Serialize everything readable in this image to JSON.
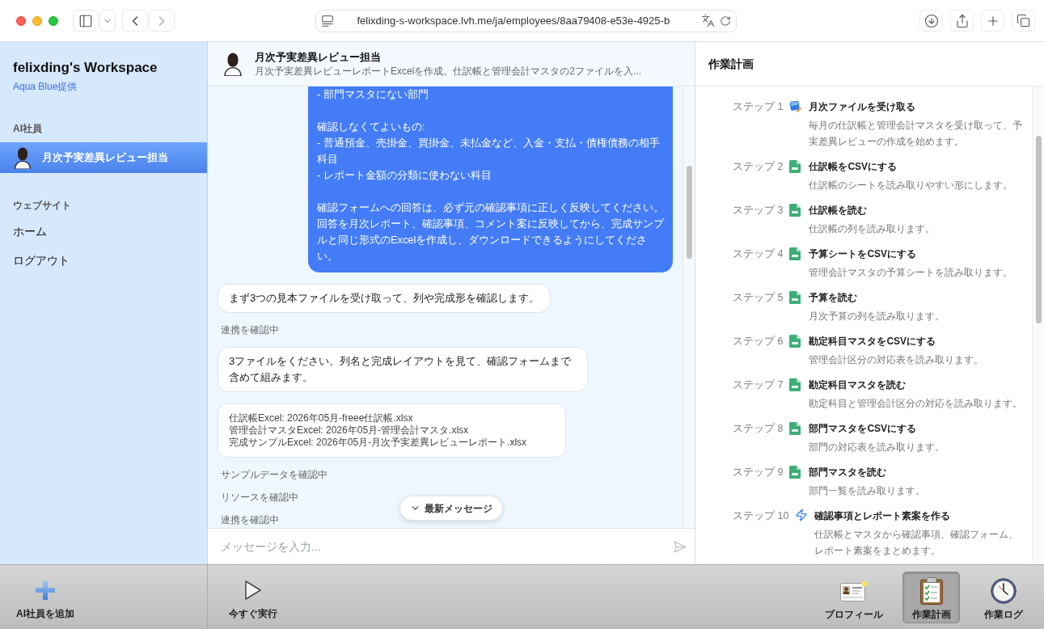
{
  "browser": {
    "url": "felixding-s-workspace.lvh.me/ja/employees/8aa79408-e53e-4925-b"
  },
  "sidebar": {
    "title": "felixding's Workspace",
    "provider": "Aqua Blue提供",
    "sections": [
      {
        "label": "AI社員",
        "items": [
          {
            "kind": "employee",
            "label": "月次予実差異レビュー担当",
            "selected": true
          }
        ]
      },
      {
        "label": "ウェブサイト",
        "items": [
          {
            "kind": "link",
            "label": "ホーム",
            "selected": false
          },
          {
            "kind": "link",
            "label": "ログアウト",
            "selected": false
          }
        ]
      }
    ]
  },
  "chat": {
    "title": "月次予実差異レビュー担当",
    "subtitle": "月次予実差異レビューレポートExcelを作成。仕訳帳と管理会計マスタの2ファイルを入...",
    "messages": [
      {
        "kind": "user",
        "paragraphs": [
          [
            "- 部門マスタにない部門"
          ],
          [
            "確認しなくてよいもの:",
            "- 普通預金、売掛金、買掛金、未払金など、入金・支払・債権債務の相手科目",
            "- レポート金額の分類に使わない科目"
          ],
          [
            "確認フォームへの回答は、必ず元の確認事項に正しく反映してください。回答を月次レポート、確認事項、コメント案に反映してから、完成サンプルと同じ形式のExcelを作成し、ダウンロードできるようにしてください。"
          ]
        ]
      },
      {
        "kind": "assistant",
        "text": "まず3つの見本ファイルを受け取って、列や完成形を確認します。"
      },
      {
        "kind": "status",
        "text": "連携を確認中"
      },
      {
        "kind": "assistant",
        "text": "3ファイルをください。列名と完成レイアウトを見て、確認フォームまで含めて組みます。"
      },
      {
        "kind": "files",
        "lines": [
          "仕訳帳Excel: 2026年05月-freee仕訳帳.xlsx",
          "管理会計マスタExcel: 2026年05月-管理会計マスタ.xlsx",
          "完成サンプルExcel: 2026年05月-月次予実差異レビューレポート.xlsx"
        ]
      },
      {
        "kind": "status",
        "text": "サンプルデータを確認中"
      },
      {
        "kind": "status",
        "text": "リソースを確認中"
      },
      {
        "kind": "status",
        "text": "連携を確認中"
      }
    ],
    "jump_button": "最新メッセージ",
    "input": {
      "placeholder": "メッセージを入力..."
    }
  },
  "plan": {
    "title": "作業計画",
    "steps": [
      {
        "kind": "intake",
        "label": "ステップ 1",
        "title": "月次ファイルを受け取る",
        "description": "毎月の仕訳帳と管理会計マスタを受け取って、予実差異レビューの作成を始めます。"
      },
      {
        "kind": "csv",
        "label": "ステップ 2",
        "title": "仕訳帳をCSVにする",
        "description": "仕訳帳のシートを読み取りやすい形にします。"
      },
      {
        "kind": "csv",
        "label": "ステップ 3",
        "title": "仕訳帳を読む",
        "description": "仕訳帳の列を読み取ります。"
      },
      {
        "kind": "csv",
        "label": "ステップ 4",
        "title": "予算シートをCSVにする",
        "description": "管理会計マスタの予算シートを読み取ります。"
      },
      {
        "kind": "csv",
        "label": "ステップ 5",
        "title": "予算を読む",
        "description": "月次予算の列を読み取ります。"
      },
      {
        "kind": "csv",
        "label": "ステップ 6",
        "title": "勘定科目マスタをCSVにする",
        "description": "管理会計区分の対応表を読み取ります。"
      },
      {
        "kind": "csv",
        "label": "ステップ 7",
        "title": "勘定科目マスタを読む",
        "description": "勘定科目と管理会計区分の対応を読み取ります。"
      },
      {
        "kind": "csv",
        "label": "ステップ 8",
        "title": "部門マスタをCSVにする",
        "description": "部門の対応表を読み取ります。"
      },
      {
        "kind": "csv",
        "label": "ステップ 9",
        "title": "部門マスタを読む",
        "description": "部門一覧を読み取ります。"
      },
      {
        "kind": "generate",
        "label": "ステップ 10",
        "title": "確認事項とレポート素案を作る",
        "description": "仕訳帳とマスタから確認事項、確認フォーム、レポート素案をまとめます。"
      }
    ]
  },
  "toolbar": {
    "actions": [
      {
        "kind": "add",
        "label": "AI社員を追加"
      },
      {
        "kind": "run",
        "label": "今すぐ実行"
      }
    ],
    "tabs": [
      {
        "kind": "profile",
        "label": "プロフィール",
        "selected": false
      },
      {
        "kind": "plan",
        "label": "作業計画",
        "selected": true
      },
      {
        "kind": "log",
        "label": "作業ログ",
        "selected": false
      }
    ]
  }
}
